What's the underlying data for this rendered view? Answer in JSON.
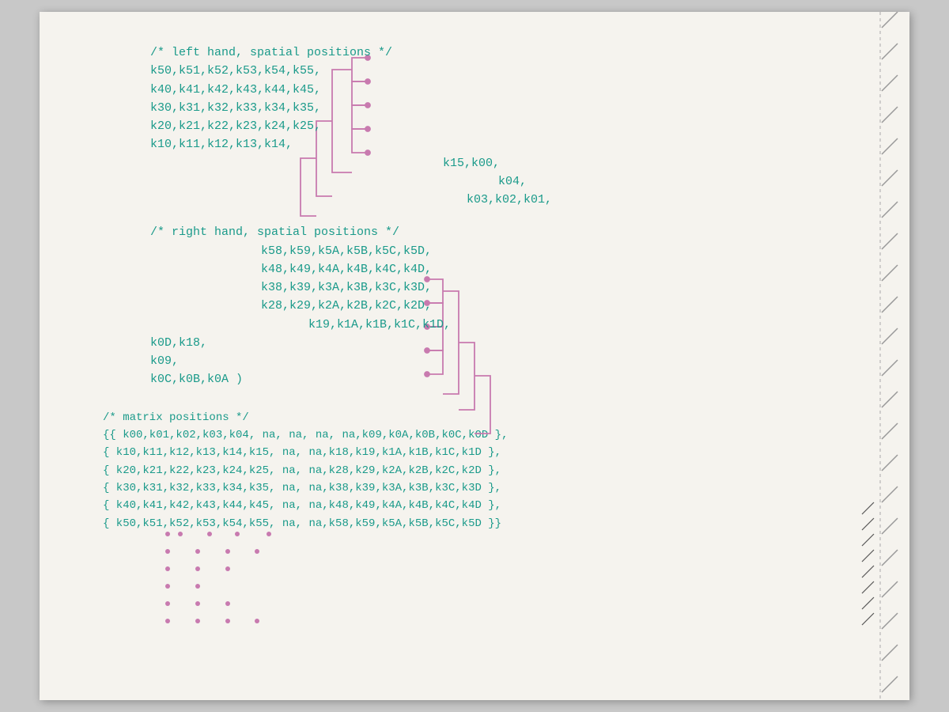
{
  "page": {
    "background": "#f5f3ee",
    "code_color": "#1a9a8a",
    "annotation_color": "#c87aaf"
  },
  "left_hand": {
    "comment": "/* left hand, spatial positions */",
    "rows": [
      "k50,k51,k52,k53,k54,k55,",
      "k40,k41,k42,k43,k44,k45,",
      "k30,k31,k32,k33,k34,k35,",
      "k20,k21,k22,k23,k24,k25,",
      "k10,k11,k12,k13,k14,",
      "k15,k00,",
      "k04,",
      "k03,k02,k01,"
    ]
  },
  "right_hand": {
    "comment": "/* right hand, spatial positions */",
    "rows": [
      "k58,k59,k5A,k5B,k5C,k5D,",
      "k48,k49,k4A,k4B,k4C,k4D,",
      "k38,k39,k3A,k3B,k3C,k3D,",
      "k28,k29,k2A,k2B,k2C,k2D,",
      "k19,k1A,k1B,k1C,k1D,",
      "k0D,k18,",
      "k09,",
      "k0C,k0B,k0A )"
    ]
  },
  "matrix": {
    "comment": "/* matrix positions */",
    "rows": [
      "{{ k00,k01,k02,k03,k04, na, na,   na, na,k09,k0A,k0B,k0C,k0D },",
      " { k10,k11,k12,k13,k14,k15, na,   na,k18,k19,k1A,k1B,k1C,k1D },",
      " { k20,k21,k22,k23,k24,k25, na,   na,k28,k29,k2A,k2B,k2C,k2D },",
      " { k30,k31,k32,k33,k34,k35, na,   na,k38,k39,k3A,k3B,k3C,k3D },",
      " { k40,k41,k42,k43,k44,k45, na,   na,k48,k49,k4A,k4B,k4C,k4D },",
      " { k50,k51,k52,k53,k54,k55, na,   na,k58,k59,k5A,k5B,k5C,k5D }}"
    ]
  }
}
